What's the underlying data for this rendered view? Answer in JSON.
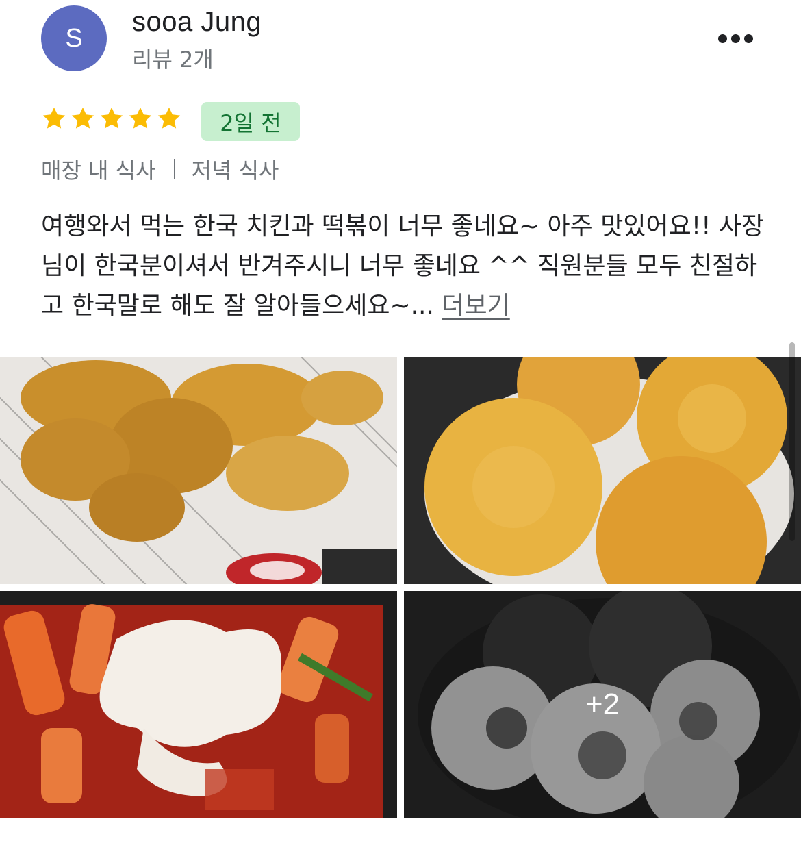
{
  "author": {
    "avatar_letter": "S",
    "avatar_color": "#5c6bc0",
    "name": "sooa Jung",
    "review_count": "리뷰 2개"
  },
  "rating": {
    "stars": 5,
    "max_stars": 5,
    "star_color": "#fbbc04"
  },
  "date_badge": {
    "label": "2일 전",
    "background": "#c7efcf",
    "text_color": "#137333"
  },
  "meta": {
    "service_type": "매장 내 식사",
    "meal_type": "저녁 식사"
  },
  "review": {
    "text": "여행와서 먹는 한국 치킨과 떡볶이 너무 좋네요~ 아주 맛있어요!! 사장님이 한국분이셔서 반겨주시니 너무 좋네요 ^^ 직원분들 모두 친절하고 한국말로 해도 잘 알아들으세요~...",
    "read_more_label": "더보기"
  },
  "photos": {
    "items": [
      {
        "icon": "fried-chicken-photo"
      },
      {
        "icon": "croquette-photo"
      },
      {
        "icon": "tteokbokki-photo"
      },
      {
        "icon": "rice-ball-photo"
      }
    ],
    "more_label": "+2"
  }
}
